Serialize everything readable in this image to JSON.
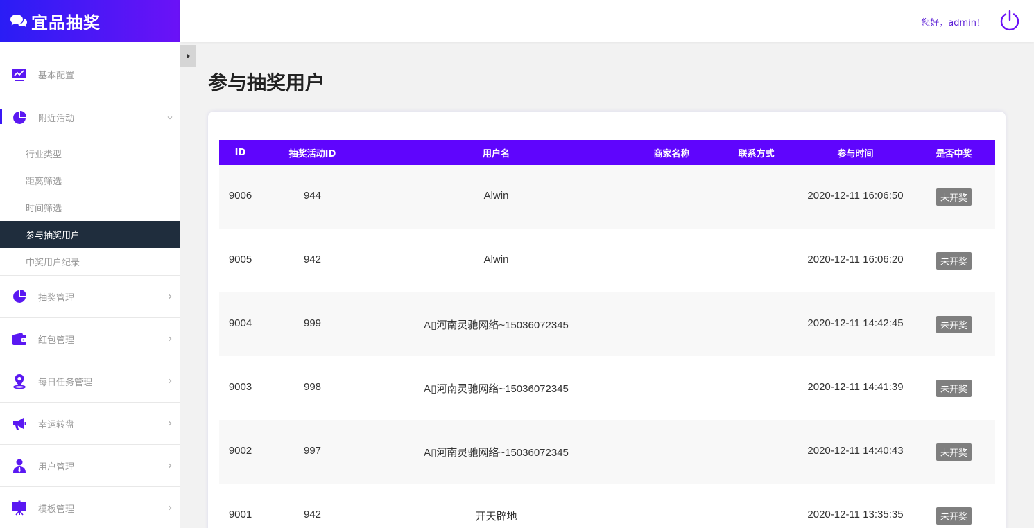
{
  "brand": {
    "title": "宜品抽奖",
    "icon": "chat-bubbles-icon"
  },
  "header": {
    "greeting": "您好，admin！",
    "power_icon": "power-icon"
  },
  "sidebar": {
    "items": [
      {
        "label": "基本配置",
        "icon": "monitor-chart-icon"
      },
      {
        "label": "附近活动",
        "icon": "pie-chart-icon",
        "open": true,
        "children": [
          {
            "label": "行业类型"
          },
          {
            "label": "距离筛选"
          },
          {
            "label": "时间筛选"
          },
          {
            "label": "参与抽奖用户",
            "active": true
          },
          {
            "label": "中奖用户纪录"
          }
        ]
      },
      {
        "label": "抽奖管理",
        "icon": "pie-chart-icon"
      },
      {
        "label": "红包管理",
        "icon": "wallet-icon"
      },
      {
        "label": "每日任务管理",
        "icon": "map-pin-icon"
      },
      {
        "label": "幸运转盘",
        "icon": "megaphone-icon"
      },
      {
        "label": "用户管理",
        "icon": "user-icon"
      },
      {
        "label": "模板管理",
        "icon": "easel-icon"
      }
    ]
  },
  "page": {
    "title": "参与抽奖用户"
  },
  "table": {
    "headers": [
      "ID",
      "抽奖活动ID",
      "用户名",
      "商家名称",
      "联系方式",
      "参与时间",
      "是否中奖"
    ],
    "rows": [
      {
        "id": "9006",
        "activity_id": "944",
        "username": "Alwin",
        "merchant": "",
        "contact": "",
        "time": "2020-12-11 16:06:50",
        "status": "未开奖"
      },
      {
        "id": "9005",
        "activity_id": "942",
        "username": "Alwin",
        "merchant": "",
        "contact": "",
        "time": "2020-12-11 16:06:20",
        "status": "未开奖"
      },
      {
        "id": "9004",
        "activity_id": "999",
        "username": "A▯河南灵驰网络~15036072345",
        "merchant": "",
        "contact": "",
        "time": "2020-12-11 14:42:45",
        "status": "未开奖"
      },
      {
        "id": "9003",
        "activity_id": "998",
        "username": "A▯河南灵驰网络~15036072345",
        "merchant": "",
        "contact": "",
        "time": "2020-12-11 14:41:39",
        "status": "未开奖"
      },
      {
        "id": "9002",
        "activity_id": "997",
        "username": "A▯河南灵驰网络~15036072345",
        "merchant": "",
        "contact": "",
        "time": "2020-12-11 14:40:43",
        "status": "未开奖"
      },
      {
        "id": "9001",
        "activity_id": "942",
        "username": "开天辟地",
        "merchant": "",
        "contact": "",
        "time": "2020-12-11 13:35:35",
        "status": "未开奖"
      }
    ]
  },
  "colors": {
    "brand_start": "#2a1df5",
    "brand_end": "#6b12f7",
    "accent": "#5f05fd",
    "active_sub_bg": "#1f2d3d",
    "badge": "#7f7f7f"
  }
}
